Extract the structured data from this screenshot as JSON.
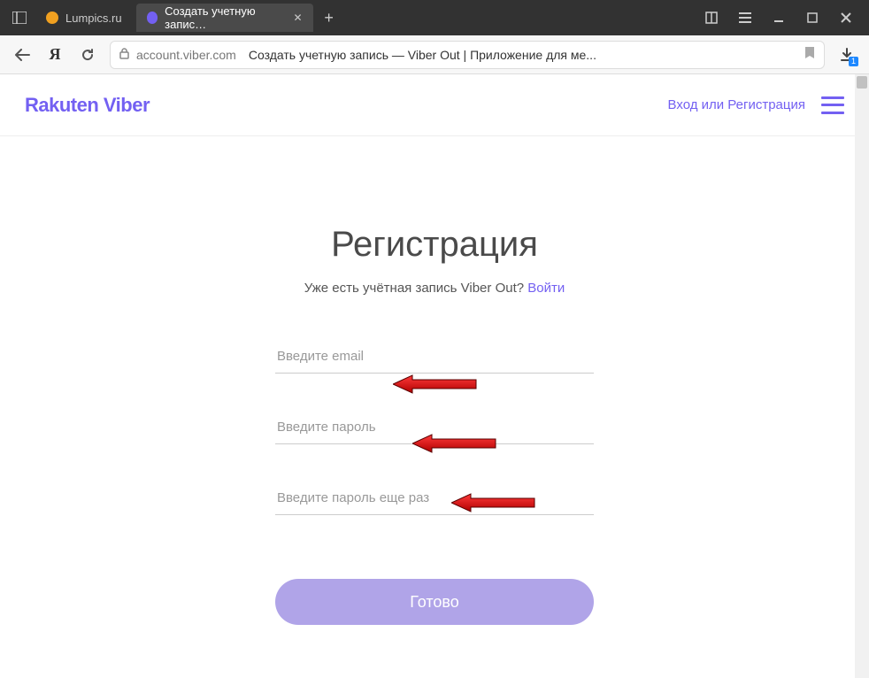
{
  "browser": {
    "tabs": [
      {
        "title": "Lumpics.ru",
        "favicon_color": "#f0a020",
        "active": false
      },
      {
        "title": "Создать учетную запис…",
        "favicon_color": "#7360f2",
        "active": true
      }
    ],
    "url_domain": "account.viber.com",
    "url_title": "Создать учетную запись — Viber Out | Приложение для ме...",
    "download_badge": "1"
  },
  "site_header": {
    "logo": "Rakuten Viber",
    "login_link": "Вход или Регистрация"
  },
  "form": {
    "title": "Регистрация",
    "already_text": "Уже есть учётная запись Viber Out? ",
    "login_word": "Войти",
    "email_placeholder": "Введите email",
    "password_placeholder": "Введите пароль",
    "password2_placeholder": "Введите пароль еще раз",
    "submit": "Готово"
  }
}
